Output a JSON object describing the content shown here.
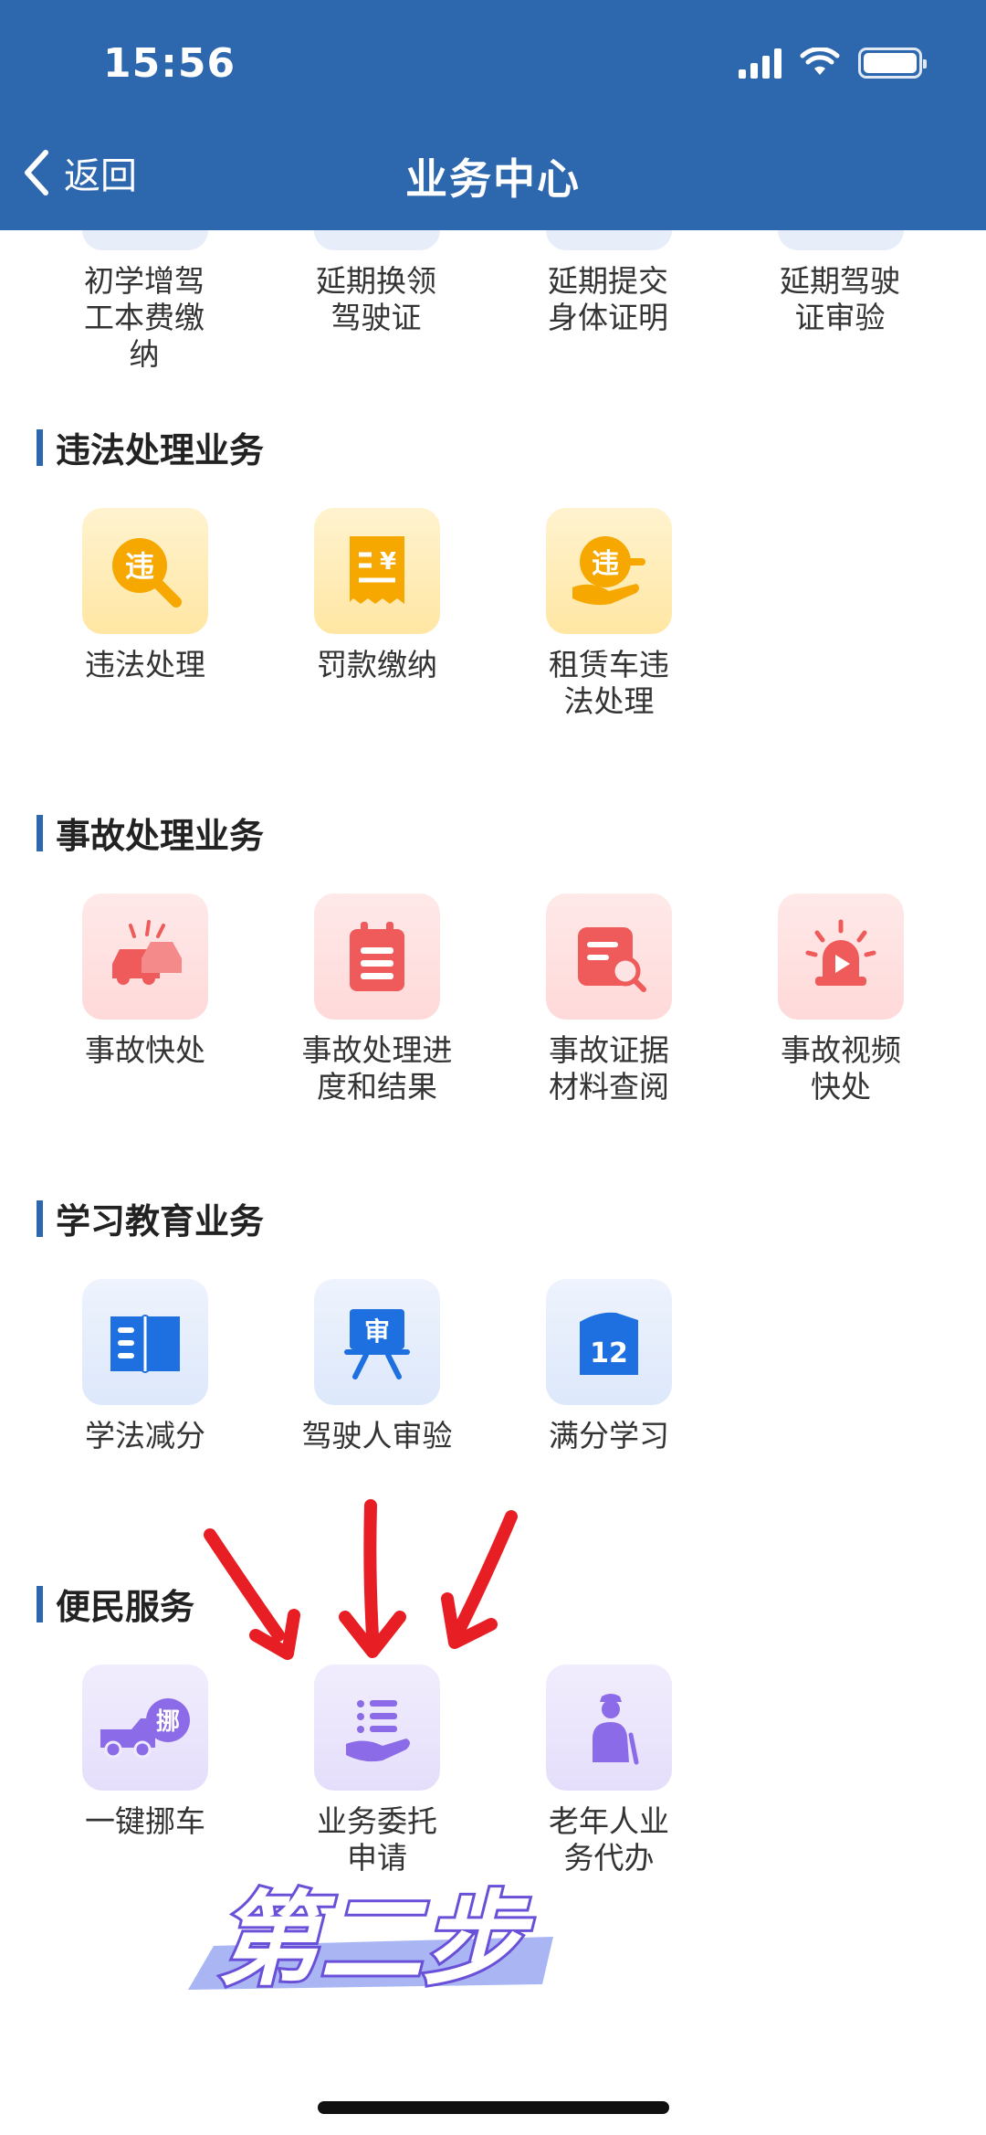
{
  "status_bar": {
    "time": "15:56"
  },
  "nav": {
    "back_label": "返回",
    "title": "业务中心"
  },
  "top_row": {
    "items": [
      {
        "label": "初学增驾工本费缴纳"
      },
      {
        "label": "延期换领驾驶证"
      },
      {
        "label": "延期提交身体证明"
      },
      {
        "label": "延期驾驶证审验"
      }
    ]
  },
  "sections": [
    {
      "title": "违法处理业务",
      "items": [
        {
          "label": "违法处理",
          "icon": "violation-search-icon"
        },
        {
          "label": "罚款缴纳",
          "icon": "fine-receipt-icon"
        },
        {
          "label": "租赁车违法处理",
          "icon": "rental-violation-icon"
        }
      ]
    },
    {
      "title": "事故处理业务",
      "items": [
        {
          "label": "事故快处",
          "icon": "car-crash-icon"
        },
        {
          "label": "事故处理进度和结果",
          "icon": "calendar-list-icon"
        },
        {
          "label": "事故证据材料查阅",
          "icon": "document-search-icon"
        },
        {
          "label": "事故视频快处",
          "icon": "alarm-video-icon"
        }
      ]
    },
    {
      "title": "学习教育业务",
      "items": [
        {
          "label": "学法减分",
          "icon": "book-icon"
        },
        {
          "label": "驾驶人审验",
          "icon": "review-board-icon",
          "glyph": "审"
        },
        {
          "label": "满分学习",
          "icon": "calendar-12-icon",
          "glyph": "12"
        }
      ]
    },
    {
      "title": "便民服务",
      "items": [
        {
          "label": "一键挪车",
          "icon": "tow-truck-icon",
          "glyph": "挪"
        },
        {
          "label": "业务委托申请",
          "icon": "delegate-hand-icon"
        },
        {
          "label": "老年人业务代办",
          "icon": "elderly-person-icon"
        }
      ]
    }
  ],
  "annotation": {
    "step_text": "第二步"
  },
  "colors": {
    "header": "#2d67ae",
    "yellow_icon": "#f6a800",
    "red_icon": "#ef5a5a",
    "blue_icon": "#1e6fe0",
    "purple_icon": "#8b6be8",
    "arrow_red": "#e81e25"
  }
}
